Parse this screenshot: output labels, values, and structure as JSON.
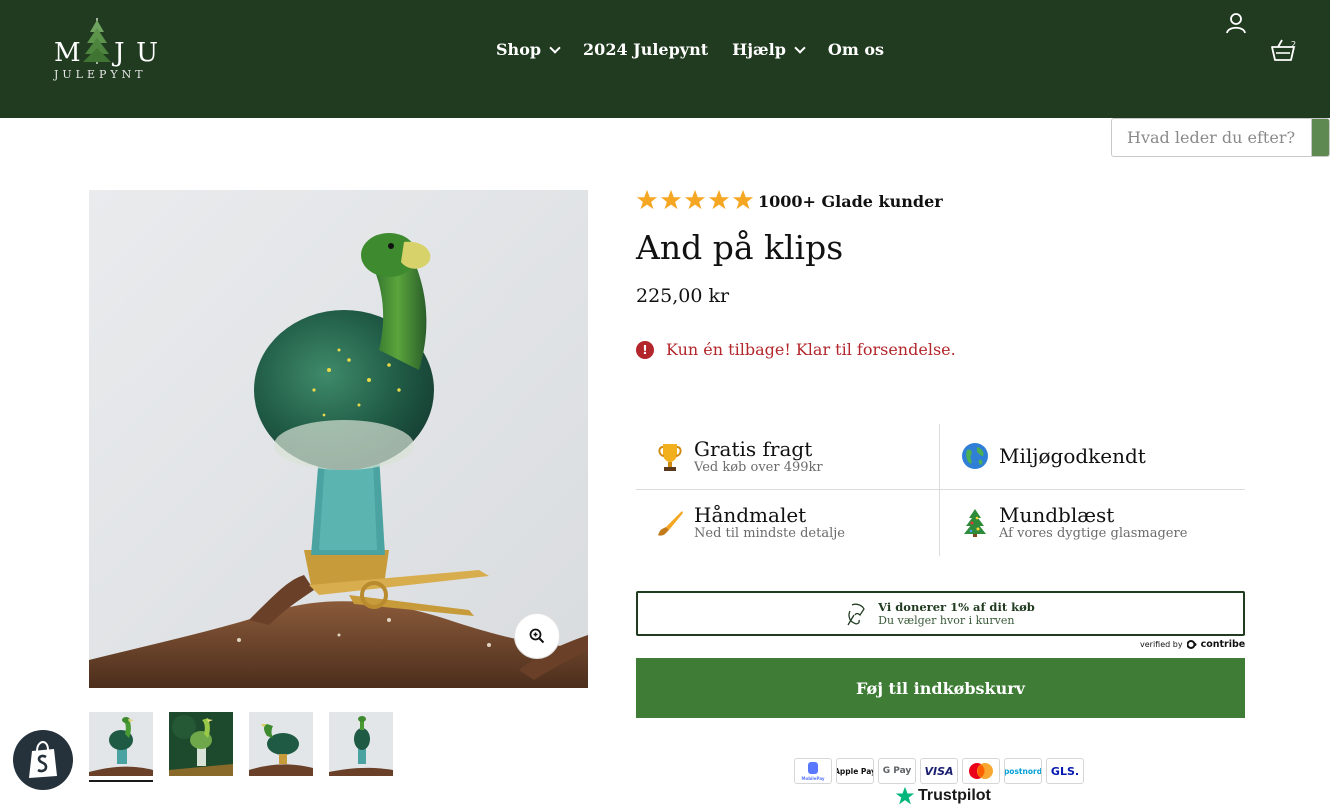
{
  "brand": {
    "logo_main": [
      "M",
      "I",
      "J",
      "U"
    ],
    "logo_sub": "JULEPYNT"
  },
  "nav": [
    {
      "label": "Shop",
      "has_dropdown": true
    },
    {
      "label": "2024 Julepynt",
      "has_dropdown": false
    },
    {
      "label": "Hjælp",
      "has_dropdown": true
    },
    {
      "label": "Om os",
      "has_dropdown": false
    }
  ],
  "cart": {
    "count": "2"
  },
  "search": {
    "placeholder": "Hvad leder du efter?"
  },
  "product": {
    "rating_stars": 5,
    "rating_text": "1000+ Glade kunder",
    "title": "And på klips",
    "price": "225,00 kr",
    "stock_text": "Kun én tilbage! Klar til forsendelse."
  },
  "features": [
    {
      "icon": "trophy-icon",
      "title": "Gratis fragt",
      "sub": "Ved køb over 499kr"
    },
    {
      "icon": "globe-icon",
      "title": "Miljøgodkendt",
      "sub": ""
    },
    {
      "icon": "paintbrush-icon",
      "title": "Håndmalet",
      "sub": "Ned til mindste detalje"
    },
    {
      "icon": "christmas-tree-icon",
      "title": "Mundblæst",
      "sub": "Af vores dygtige glasmagere"
    }
  ],
  "donation": {
    "title": "Vi donerer 1% af dit køb",
    "sub": "Du vælger hvor i kurven",
    "verified_by": "verified by",
    "verified_brand": "contribe"
  },
  "add_to_cart": "Føj til indkøbskurv",
  "payments": [
    "MobilePay",
    "Apple Pay",
    "G Pay",
    "VISA",
    "Mastercard",
    "postnord",
    "GLS."
  ],
  "trustpilot": "Trustpilot",
  "colors": {
    "header_bg": "#213b21",
    "button_bg": "#3f7d37",
    "stock_red": "#b3262b",
    "star": "#f5a623"
  }
}
